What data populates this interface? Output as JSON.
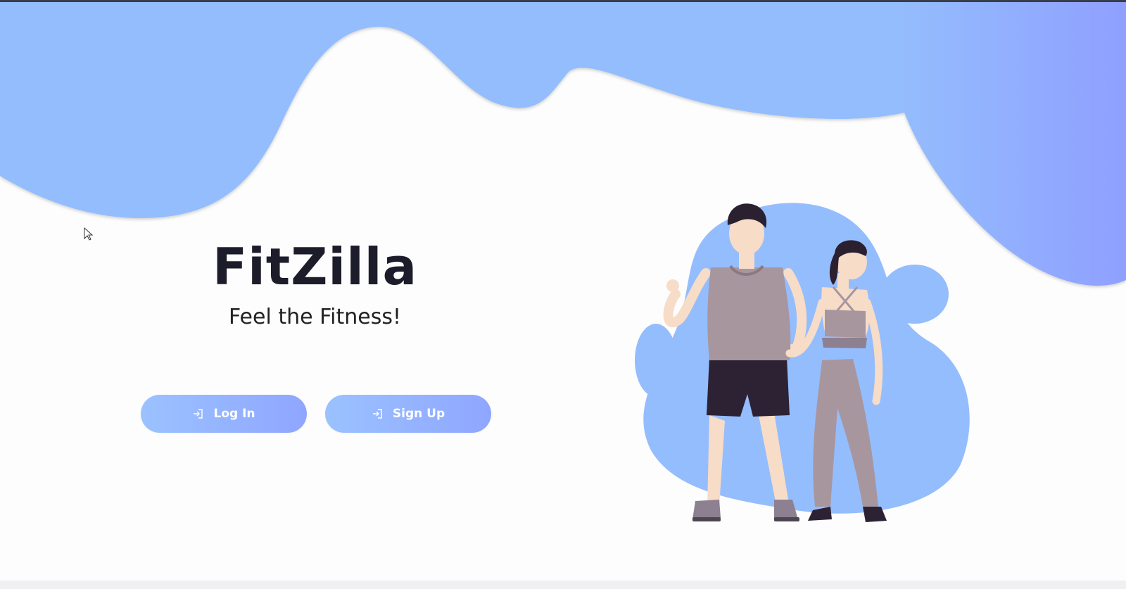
{
  "app": {
    "title": "FitZilla",
    "tagline": "Feel the Fitness!"
  },
  "actions": {
    "login_label": "Log In",
    "signup_label": "Sign Up"
  },
  "icons": {
    "login": "login-arrow-icon",
    "signup": "login-arrow-icon",
    "cursor": "mouse-pointer-icon"
  },
  "colors": {
    "wave": "#94bdfd",
    "wave_right": "#8fa0ff",
    "button_start": "#9bc2ff",
    "button_end": "#8fa6ff",
    "title": "#1c1c2b"
  },
  "illustration": {
    "name": "fitness-couple-illustration"
  }
}
